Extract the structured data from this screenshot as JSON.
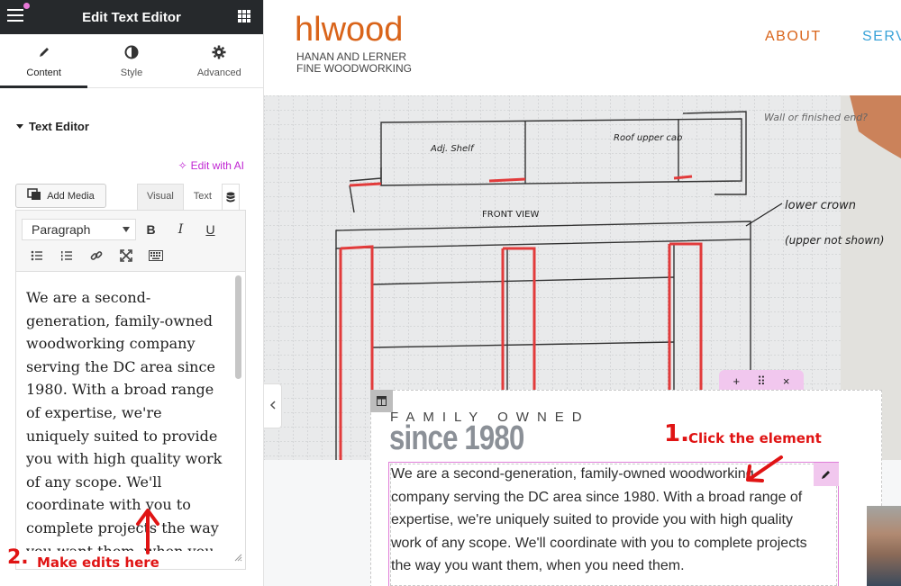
{
  "panel": {
    "title": "Edit Text Editor",
    "tabs": [
      {
        "label": "Content",
        "icon": "pencil-icon",
        "active": true
      },
      {
        "label": "Style",
        "icon": "half-circle-icon",
        "active": false
      },
      {
        "label": "Advanced",
        "icon": "gear-icon",
        "active": false
      }
    ],
    "section_title": "Text Editor",
    "edit_ai_label": "Edit with AI",
    "add_media_label": "Add Media",
    "mode_tabs": [
      "Visual",
      "Text"
    ],
    "format_select": "Paragraph",
    "toolbar_buttons": [
      "B",
      "I",
      "U"
    ],
    "editor_text": "We are a second-generation, family-owned woodworking company serving the DC area since 1980. With a broad range of expertise, we're uniquely suited to provide you with high quality work of any scope. We'll coordinate with you to complete projects the way you want them, when you need them."
  },
  "annotations": {
    "step1_num": "1.",
    "step1_text": "Click the element",
    "step2_num": "2.",
    "step2_text": "Make edits here",
    "color": "#e01414"
  },
  "site": {
    "logo": "hlwood",
    "logo_sub1": "HANAN AND LERNER",
    "logo_sub2": "FINE WOODWORKING",
    "nav": [
      "ABOUT",
      "SERV"
    ],
    "eyebrow": "FAMILY OWNED",
    "headline": "since 1980",
    "body": "We are a second-generation, family-owned woodworking company serving the DC area since 1980. With a broad range of expertise, we're uniquely suited to provide you with high quality work of any scope. We'll coordinate with you to complete projects the way you want them, when you need them.",
    "section_controls": [
      "+",
      "⠿",
      "×"
    ],
    "sketch_labels": [
      "FRONT VIEW",
      "lower crown",
      "(upper not shown)",
      "Wall or finished end?",
      "Adj. Shelf",
      "Roof upper cab"
    ]
  },
  "colors": {
    "accent_orange": "#d9641a",
    "accent_blue": "#3aa3d8",
    "editor_pink": "#e07ed8",
    "ai_magenta": "#c026d3",
    "panel_dark": "#26292c"
  }
}
